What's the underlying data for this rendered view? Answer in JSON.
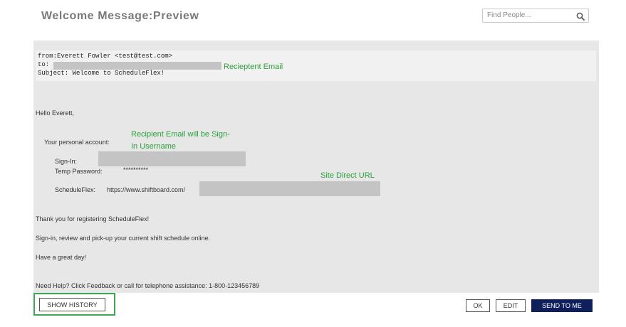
{
  "page": {
    "title": "Welcome Message:Preview"
  },
  "search": {
    "placeholder": "Find People..."
  },
  "email": {
    "from": "from:Everett Fowler <test@test.com>",
    "to": "to:",
    "subject": "Subject: Welcome to ScheduleFlex!",
    "greeting": "Hello Everett,",
    "account_label": "Your personal account:",
    "signin_label": "Sign-In:",
    "temp_password_label": "Temp Password:",
    "temp_password_value": "**********",
    "scheduleflex_label": "ScheduleFlex:",
    "url_prefix": "https://www.shiftboard.com/",
    "thanks": "Thank you for registering ScheduleFlex!",
    "instructions": "Sign-in, review and pick-up your current shift schedule online.",
    "closing": "Have a great day!",
    "help": "Need Help? Click Feedback or call for telephone assistance: 1-800-123456789"
  },
  "annotations": {
    "recipient_email": "Recieptent Email",
    "signin_note_line1": "Recipient Email will be Sign-",
    "signin_note_line2": "In Username",
    "site_url": "Site Direct URL"
  },
  "footer": {
    "show_history": "SHOW HISTORY",
    "ok": "OK",
    "edit": "EDIT",
    "send_to_me": "SEND TO ME"
  },
  "colors": {
    "annotation_green": "#2aa13a",
    "primary_button": "#0f1f5c",
    "redaction_gray": "#c4c4c4"
  }
}
